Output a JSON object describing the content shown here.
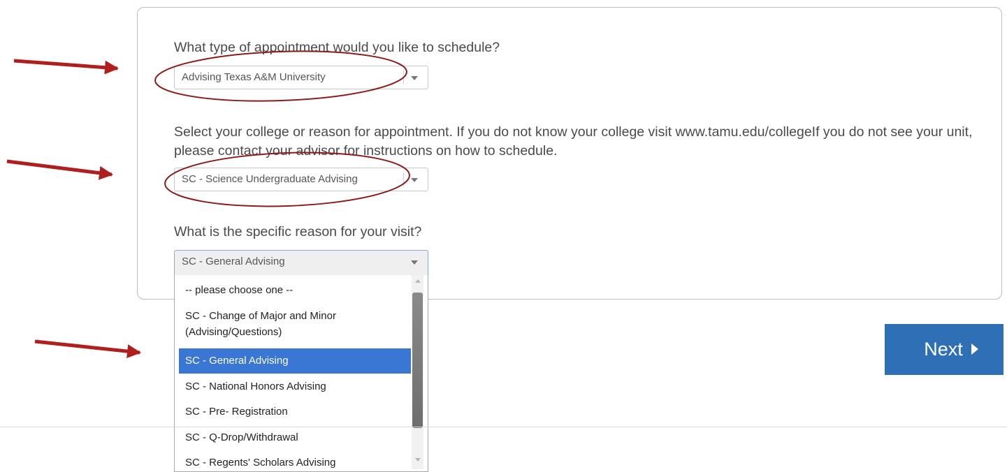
{
  "form": {
    "q1_label": "What type of appointment would you like to schedule?",
    "q1_value": "Advising Texas A&M University",
    "q2_label": "Select your college or reason for appointment. If you do not know your college visit www.tamu.edu/collegeIf you do not see your unit, please contact your advisor for instructions on how to schedule.",
    "q2_value": "SC - Science Undergraduate Advising",
    "q3_label": "What is the specific reason for your visit?",
    "q3_value": "SC - General Advising"
  },
  "dropdown": {
    "options": [
      "-- please choose one --",
      "SC - Change of Major and Minor (Advising/Questions)",
      "SC - General Advising",
      "SC - National Honors Advising",
      "SC - Pre- Registration",
      "SC - Q-Drop/Withdrawal",
      "SC - Regents' Scholars Advising"
    ],
    "selected_index": 2
  },
  "next_label": "Next",
  "colors": {
    "annotation": "#b01e1e",
    "selected_option": "#3a76d4",
    "next_button": "#2f6fb6"
  }
}
